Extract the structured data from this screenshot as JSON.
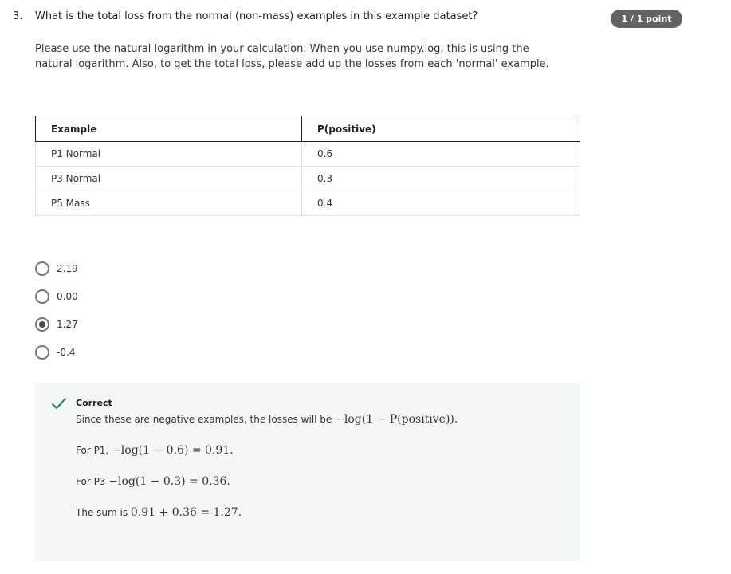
{
  "question": {
    "number": "3.",
    "text": "What is the total loss from the normal (non-mass) examples in this example dataset?",
    "points": "1 / 1 point",
    "instructions": "Please use the natural logarithm in your calculation. When you use numpy.log, this is using the natural logarithm. Also, to get the total loss, please add up the losses from each 'normal' example."
  },
  "table": {
    "headers": [
      "Example",
      "P(positive)"
    ],
    "rows": [
      [
        "P1 Normal",
        "0.6"
      ],
      [
        "P3 Normal",
        "0.3"
      ],
      [
        "P5 Mass",
        "0.4"
      ]
    ]
  },
  "options": [
    {
      "label": "2.19",
      "selected": false
    },
    {
      "label": "0.00",
      "selected": false
    },
    {
      "label": "1.27",
      "selected": true
    },
    {
      "label": "-0.4",
      "selected": false
    }
  ],
  "feedback": {
    "status": "Correct",
    "intro": "Since these are negative examples, the losses will be",
    "intro_math": "−log(1 − P(positive)).",
    "p1_label": "For P1,",
    "p1_math": "−log(1 − 0.6) = 0.91.",
    "p3_label": "For P3",
    "p3_math": "−log(1 − 0.3) = 0.36.",
    "sum_label": "The sum is",
    "sum_math": "0.91 + 0.36 = 1.27."
  },
  "colors": {
    "badge": "#636363",
    "feedback_bg": "#f3f8f6",
    "correct_green": "#1f8354"
  }
}
